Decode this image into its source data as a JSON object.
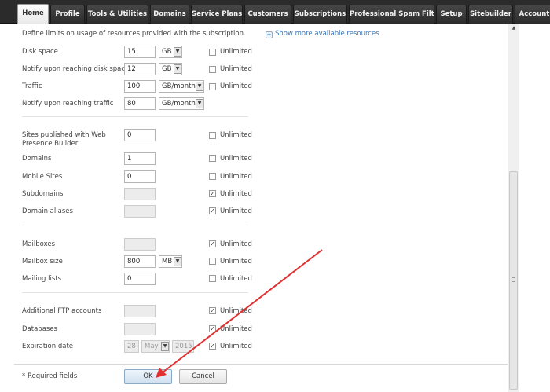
{
  "nav": {
    "tabs": [
      {
        "label": "Home"
      },
      {
        "label": "Profile"
      },
      {
        "label": "Tools & Utilities"
      },
      {
        "label": "Domains"
      },
      {
        "label": "Service Plans"
      },
      {
        "label": "Customers"
      },
      {
        "label": "Subscriptions"
      },
      {
        "label": "Professional Spam Filter"
      },
      {
        "label": "Setup"
      },
      {
        "label": "Sitebuilder"
      },
      {
        "label": "Account"
      }
    ],
    "active_tab": "Home"
  },
  "intro": "Define limits on usage of resources provided with the subscription.",
  "more_link": "Show more available resources",
  "unlimited_label": "Unlimited",
  "rows": {
    "disk_space": {
      "label": "Disk space",
      "value": "15",
      "unit": "GB",
      "unlimited": false
    },
    "notify_disk": {
      "label": "Notify upon reaching disk space",
      "value": "12",
      "unit": "GB",
      "unlimited": false
    },
    "traffic": {
      "label": "Traffic",
      "value": "100",
      "unit": "GB/month",
      "unlimited": false
    },
    "notify_traffic": {
      "label": "Notify upon reaching traffic",
      "value": "80",
      "unit": "GB/month"
    },
    "sites_wpb": {
      "label_line1": "Sites published with Web",
      "label_line2": "Presence Builder",
      "value": "0",
      "unlimited": false
    },
    "domains": {
      "label": "Domains",
      "value": "1",
      "unlimited": false
    },
    "mobile_sites": {
      "label": "Mobile Sites",
      "value": "0",
      "unlimited": false
    },
    "subdomains": {
      "label": "Subdomains",
      "value": "",
      "unlimited": true
    },
    "domain_aliases": {
      "label": "Domain aliases",
      "value": "",
      "unlimited": true
    },
    "mailboxes": {
      "label": "Mailboxes",
      "value": "",
      "unlimited": true
    },
    "mailbox_size": {
      "label": "Mailbox size",
      "value": "800",
      "unit": "MB",
      "unlimited": false
    },
    "mailing_lists": {
      "label": "Mailing lists",
      "value": "0",
      "unlimited": false
    },
    "ftp_accounts": {
      "label": "Additional FTP accounts",
      "value": "",
      "unlimited": true
    },
    "databases": {
      "label": "Databases",
      "value": "",
      "unlimited": true
    },
    "expiration": {
      "label": "Expiration date",
      "day": "28",
      "month": "May",
      "year": "2015",
      "unlimited": true
    }
  },
  "footer": {
    "required": "* Required fields",
    "ok": "OK",
    "cancel": "Cancel"
  },
  "colors": {
    "annotation_arrow": "#e03030",
    "link": "#3a77b8",
    "nav_bg": "#2b2b2b"
  }
}
